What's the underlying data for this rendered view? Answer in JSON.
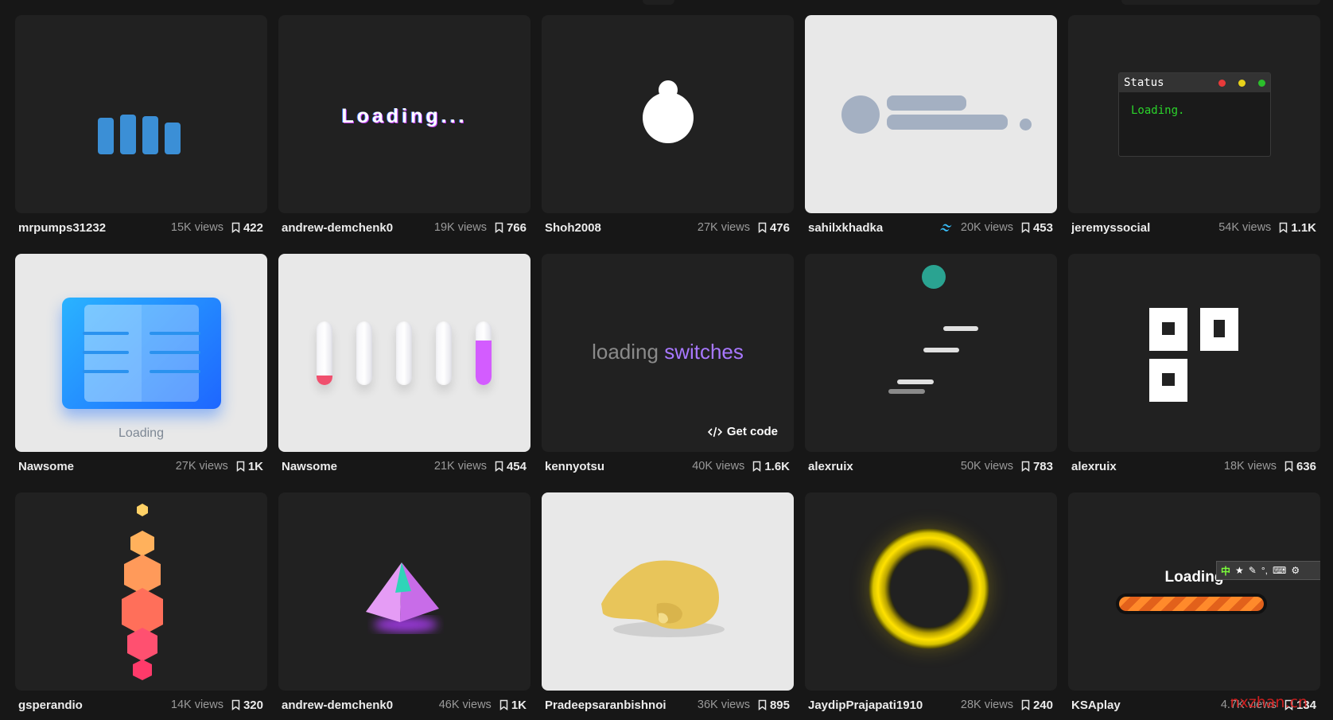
{
  "cards": [
    {
      "author": "mrpumps31232",
      "views": "15K views",
      "saves": "422"
    },
    {
      "author": "andrew-demchenk0",
      "views": "19K views",
      "saves": "766",
      "preview_text": "Loading..."
    },
    {
      "author": "Shoh2008",
      "views": "27K views",
      "saves": "476"
    },
    {
      "author": "sahilxkhadka",
      "views": "20K views",
      "saves": "453",
      "tailwind_badge": true
    },
    {
      "author": "jeremyssocial",
      "views": "54K views",
      "saves": "1.1K",
      "terminal_title": "Status",
      "terminal_text": "Loading."
    },
    {
      "author": "Nawsome",
      "views": "27K views",
      "saves": "1K",
      "preview_text": "Loading"
    },
    {
      "author": "Nawsome",
      "views": "21K views",
      "saves": "454"
    },
    {
      "author": "kennyotsu",
      "views": "40K views",
      "saves": "1.6K",
      "preview_text_a": "loading ",
      "preview_text_b": "switches",
      "get_code_label": "Get code"
    },
    {
      "author": "alexruix",
      "views": "50K views",
      "saves": "783"
    },
    {
      "author": "alexruix",
      "views": "18K views",
      "saves": "636"
    },
    {
      "author": "gsperandio",
      "views": "14K views",
      "saves": "320"
    },
    {
      "author": "andrew-demchenk0",
      "views": "46K views",
      "saves": "1K"
    },
    {
      "author": "Pradeepsaranbishnoi",
      "views": "36K views",
      "saves": "895"
    },
    {
      "author": "JaydipPrajapati1910",
      "views": "28K views",
      "saves": "240"
    },
    {
      "author": "KSAplay",
      "views": "4.7K views",
      "saves": "134",
      "preview_text": "Loading"
    }
  ],
  "ime_toolbar": {
    "label": "中"
  },
  "watermark": "nxzhan.cn",
  "colors": {
    "background": "#171717",
    "card": "#212121",
    "card_light": "#e8e8e8",
    "accent_purple": "#a878ff",
    "terminal_green": "#2bd42b"
  }
}
